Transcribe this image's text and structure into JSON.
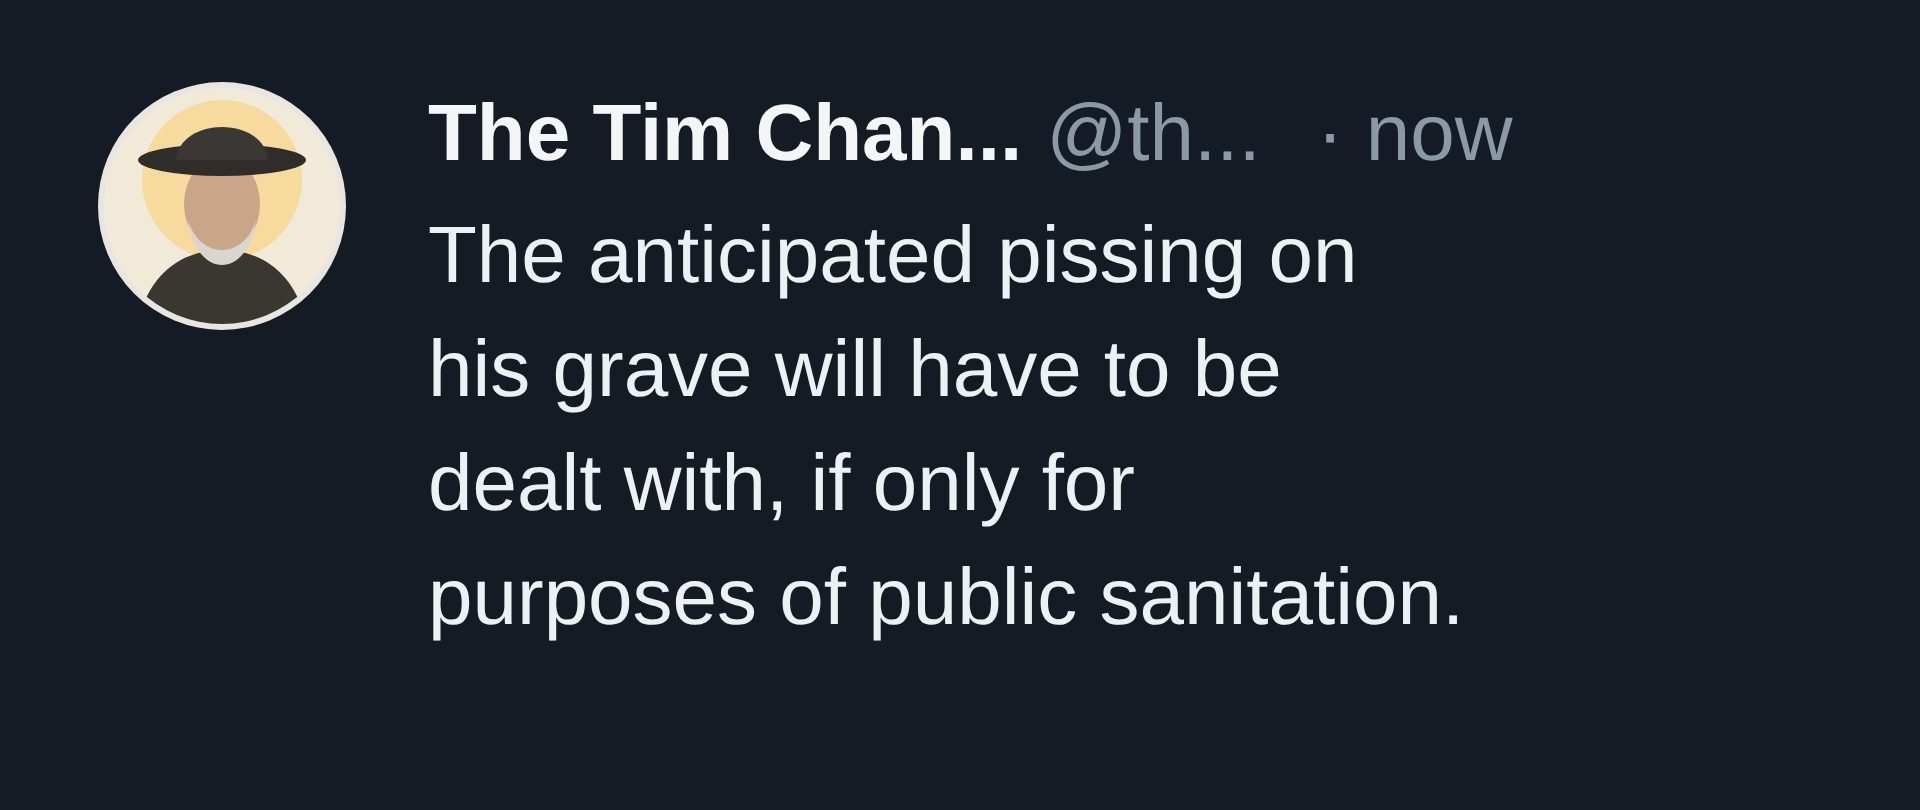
{
  "post": {
    "author": {
      "name": "The Tim Chan...",
      "handle": "@th...",
      "time": "· now"
    },
    "text": "The anticipated pissing on\nhis grave will have to be\ndealt with, if only for\npurposes of public sanitation."
  }
}
